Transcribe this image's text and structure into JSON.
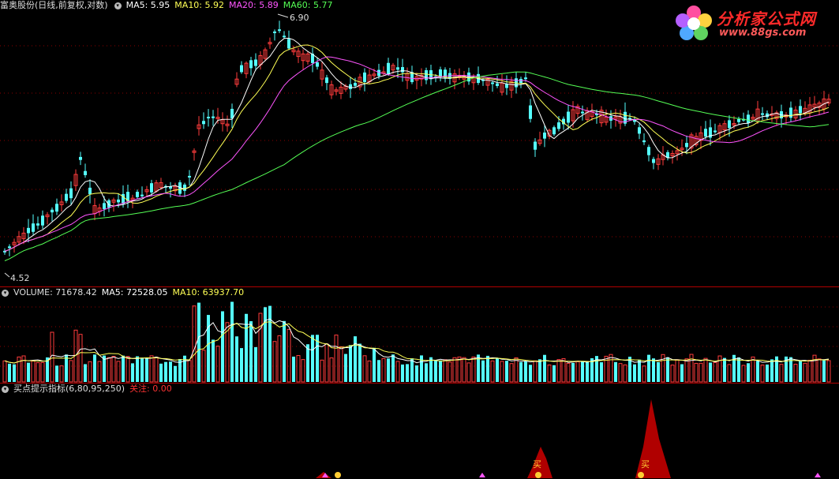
{
  "price_panel": {
    "stock_name": "富奥股份",
    "period_info": "(日线,前复权,对数)",
    "ma5": {
      "label": "MA5: 5.95",
      "color": "#ffffff"
    },
    "ma10": {
      "label": "MA10: 5.92",
      "color": "#ffff55"
    },
    "ma20": {
      "label": "MA20: 5.89",
      "color": "#ff55ff"
    },
    "ma60": {
      "label": "MA60: 5.77",
      "color": "#55ff55"
    },
    "high_label": "6.90",
    "low_label": "4.52"
  },
  "volume_panel": {
    "volume": {
      "label": "VOLUME: 71678.42",
      "color": "#dddddd"
    },
    "ma5": {
      "label": "MA5: 72528.05",
      "color": "#ffffff"
    },
    "ma10": {
      "label": "MA10: 63937.70",
      "color": "#ffff55"
    }
  },
  "indicator_panel": {
    "name": "买点提示指标(6,80,95,250)",
    "focus": {
      "label": "关注: 0.00",
      "color": "#ff3333"
    },
    "buy_label": "买"
  },
  "logo": {
    "text": "分析家公式网",
    "url_text": "www.88gs.com"
  },
  "colors": {
    "up": "#ff3c3c",
    "down": "#55ffff",
    "grid": "#8b0000"
  }
}
